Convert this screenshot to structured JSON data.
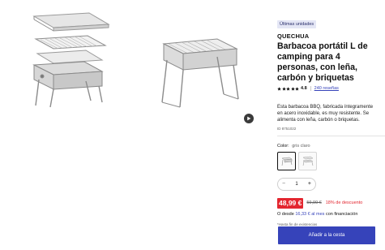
{
  "gallery": {
    "image_1_alt": "barbacoa-open-exploded-icon",
    "image_2_alt": "barbacoa-assembled-icon",
    "play_icon": "play-icon"
  },
  "product": {
    "badge": "Últimas unidades",
    "brand": "QUECHUA",
    "title": "Barbacoa portátil L de camping para 4 personas, con leña, carbón y briquetas",
    "rating_value": "4.8",
    "star_count": 5,
    "reviews": "240 reseñas",
    "description": "Esta barbacoa BBQ, fabricada íntegramente en acero inoxidable, es muy resistente. Se alimenta con leña, carbón o briquetas.",
    "ref": "ID 8751022"
  },
  "color": {
    "label": "Color:",
    "value": "gris claro"
  },
  "quantity": {
    "minus": "−",
    "value": "1",
    "plus": "+"
  },
  "pricing": {
    "price": "48,99 €",
    "old_price": "59,99 €",
    "discount": "18% de descuento",
    "financing_prefix": "O desde",
    "financing_amount": "16,33 € al mes",
    "financing_suffix": "con financiación",
    "stock_note": "*Hasta fin de existencias"
  },
  "cta": {
    "add_to_cart": "Añadir a la cesta"
  },
  "colors": {
    "accent": "#3643ba",
    "price_red": "#e3262f",
    "badge_bg": "#e4e6f5"
  }
}
